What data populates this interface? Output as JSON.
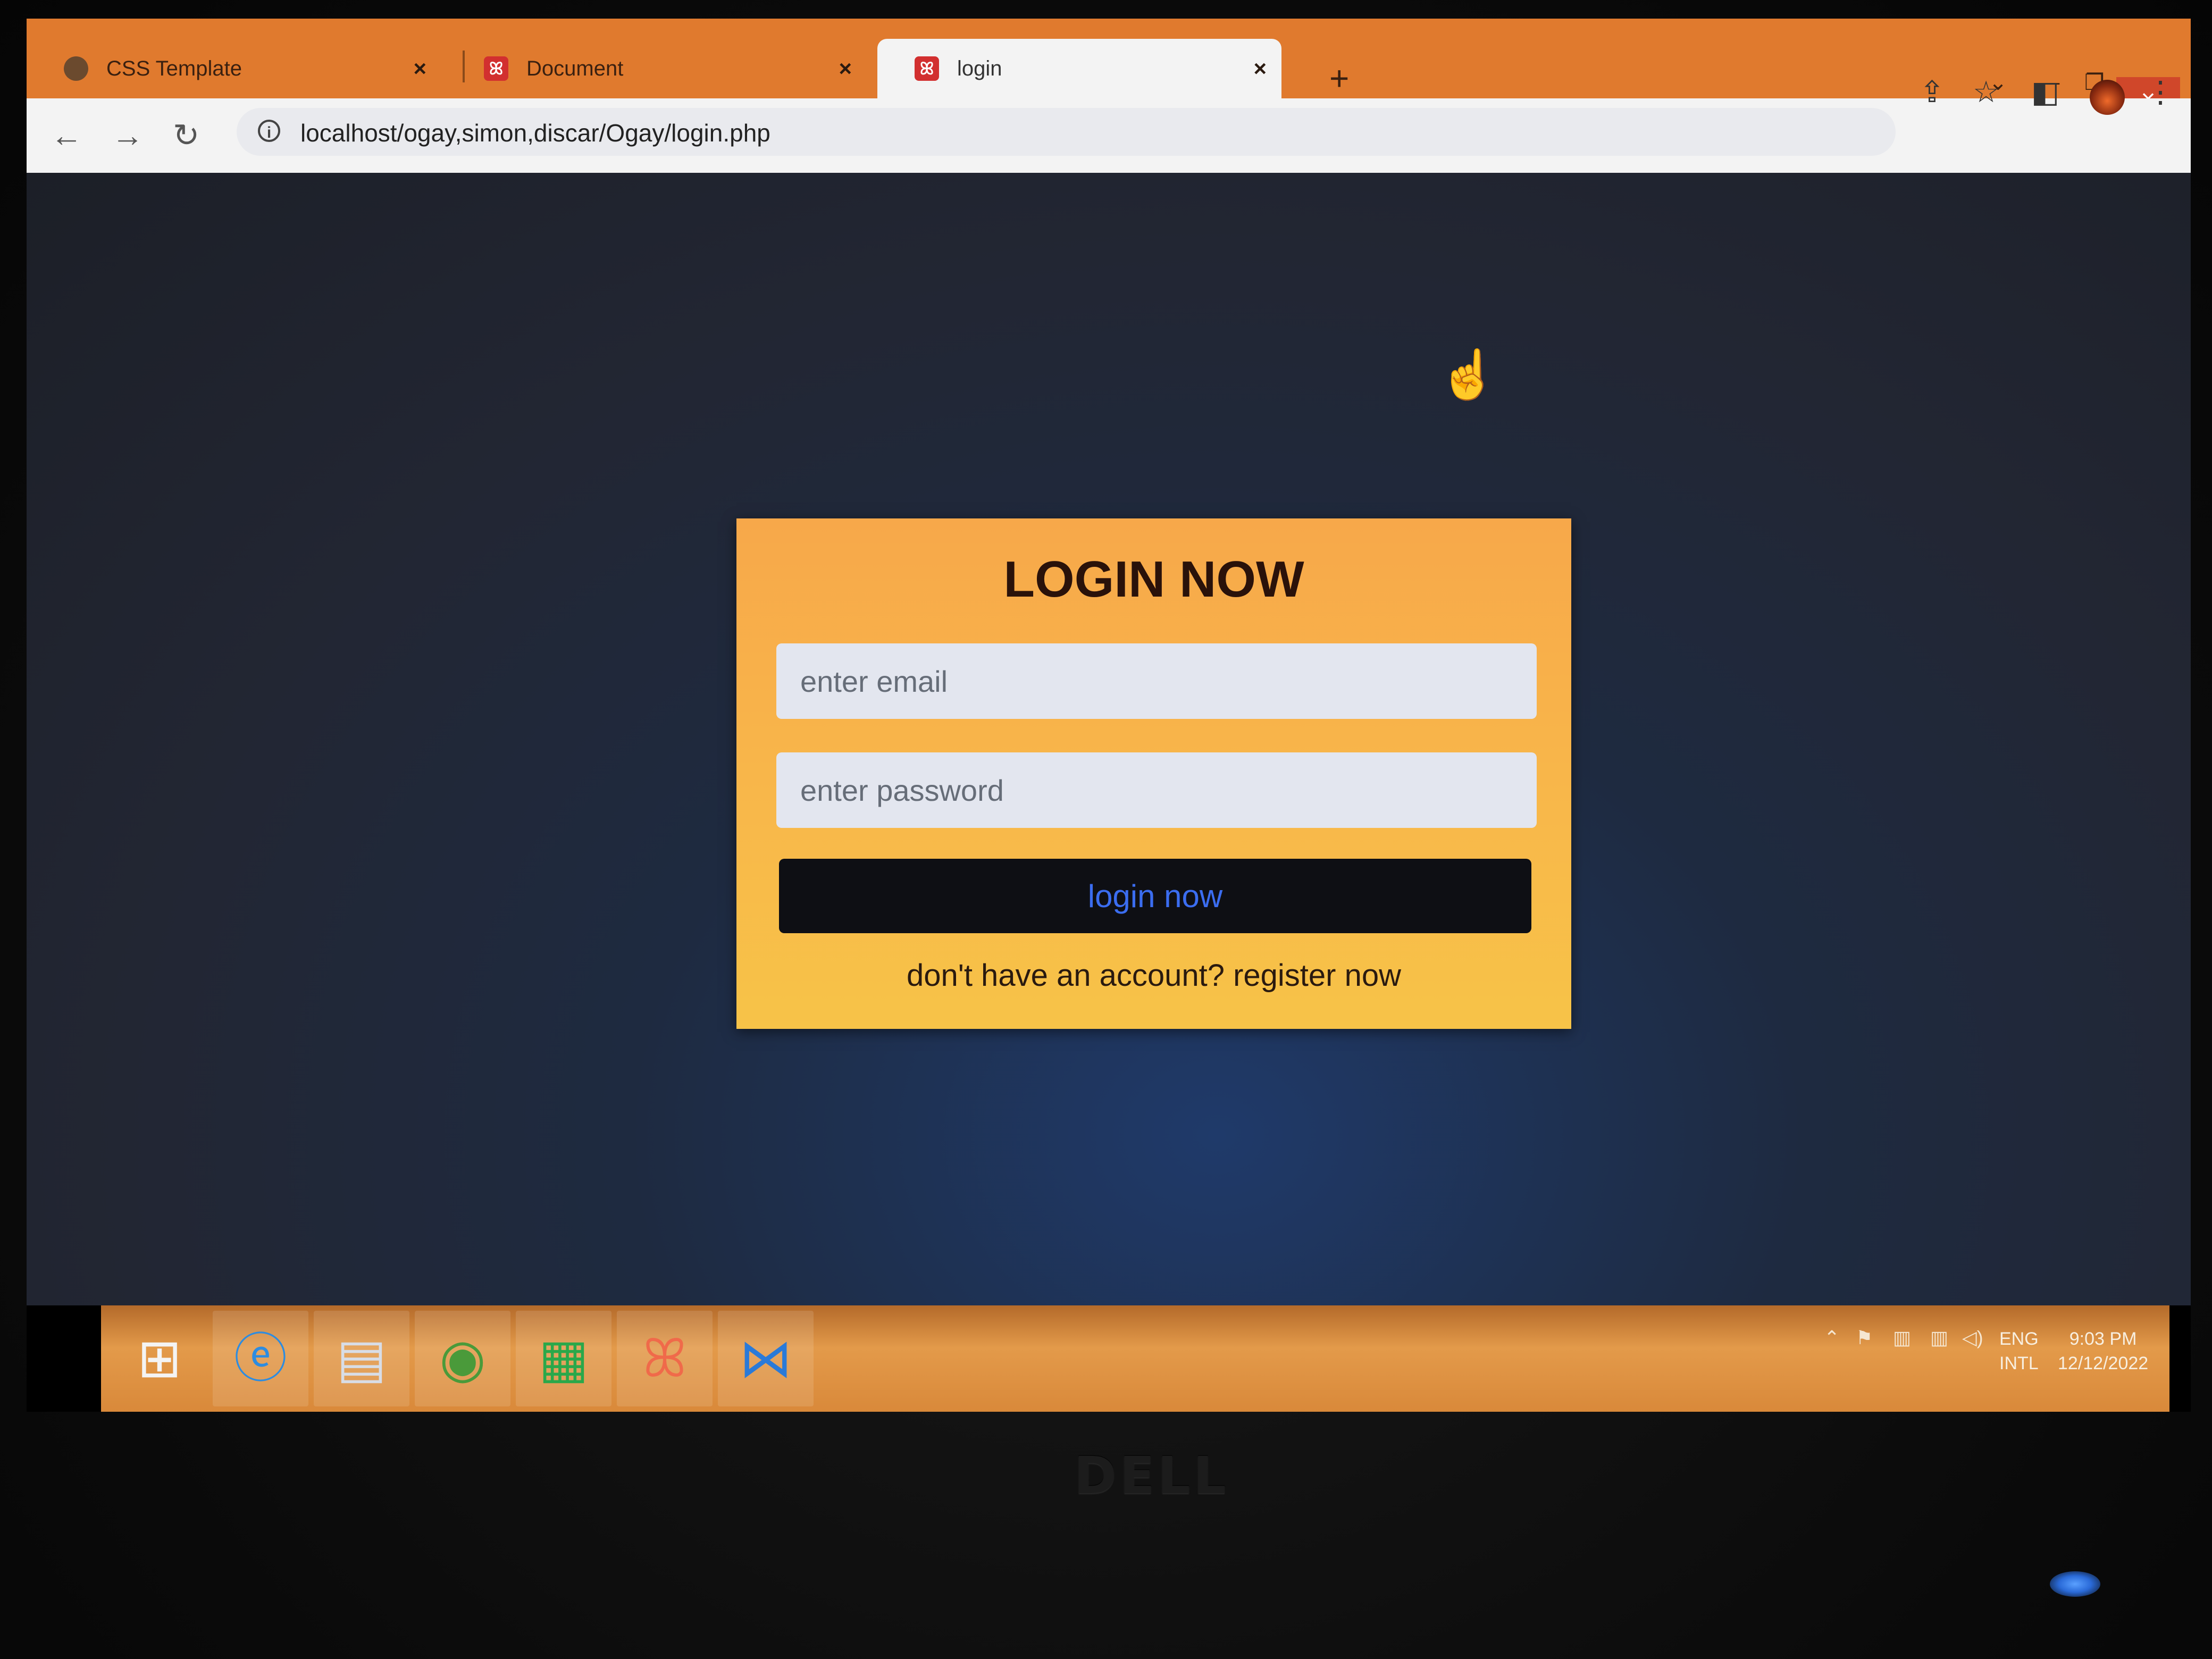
{
  "browser": {
    "tabs": [
      {
        "title": "CSS Template",
        "icon": "globe-icon"
      },
      {
        "title": "Document",
        "icon": "xampp-icon"
      },
      {
        "title": "login",
        "icon": "xampp-icon",
        "active": true
      }
    ],
    "close_glyph": "×",
    "new_tab_glyph": "+",
    "address": "localhost/ogay,simon,discar/Ogay/login.php"
  },
  "login": {
    "title": "LOGIN NOW",
    "email_placeholder": "enter email",
    "password_placeholder": "enter password",
    "submit_label": "login now",
    "register_prompt": "don't have an account?",
    "register_link": "register now"
  },
  "taskbar": {
    "apps": [
      "windows-start",
      "internet-explorer",
      "file-explorer",
      "chrome",
      "store",
      "xampp",
      "vscode"
    ],
    "language": "ENG",
    "keyboard": "INTL",
    "time": "9:03 PM",
    "date": "12/12/2022"
  },
  "monitor": {
    "brand": "DELL"
  },
  "colors": {
    "browser_chrome": "#e07a2e",
    "card_top": "#f7a84a",
    "card_bottom": "#f7c348",
    "button_bg": "#0e0f14",
    "button_text": "#3b6df0",
    "page_bg": "#1e2a40"
  }
}
